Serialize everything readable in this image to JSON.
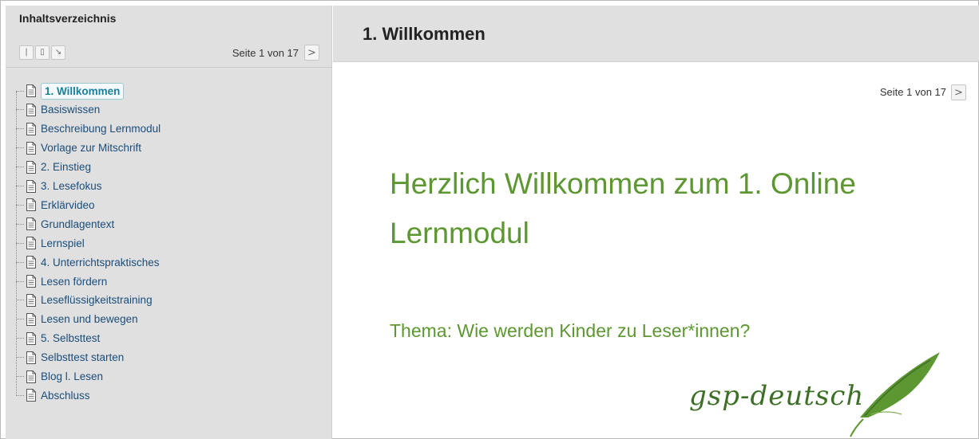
{
  "sidebar": {
    "title": "Inhaltsverzeichnis",
    "tools": [
      {
        "glyph": "|",
        "icon": "bar-icon"
      },
      {
        "glyph": "▯",
        "icon": "page-icon"
      },
      {
        "glyph": "↘",
        "icon": "arrow-icon"
      }
    ],
    "pager": {
      "label": "Seite 1 von 17",
      "next": ">"
    },
    "items": [
      {
        "label": "1. Willkommen",
        "active": true
      },
      {
        "label": "Basiswissen"
      },
      {
        "label": "Beschreibung Lernmodul"
      },
      {
        "label": "Vorlage zur Mitschrift"
      },
      {
        "label": "2. Einstieg"
      },
      {
        "label": "3. Lesefokus"
      },
      {
        "label": "Erklärvideo"
      },
      {
        "label": "Grundlagentext"
      },
      {
        "label": "Lernspiel"
      },
      {
        "label": "4. Unterrichtspraktisches"
      },
      {
        "label": "Lesen fördern"
      },
      {
        "label": "Leseflüssigkeitstraining"
      },
      {
        "label": "Lesen und bewegen"
      },
      {
        "label": "5. Selbsttest"
      },
      {
        "label": "Selbsttest starten"
      },
      {
        "label": "Blog l. Lesen"
      },
      {
        "label": "Abschluss"
      }
    ]
  },
  "content": {
    "title": "1. Willkommen",
    "pager": {
      "label": "Seite 1 von 17",
      "next": ">"
    },
    "heading_line1": "Herzlich Willkommen zum 1. Online",
    "heading_line2": "Lernmodul",
    "subtitle": "Thema: Wie werden Kinder zu Leser*innen?",
    "logo_text": "gsp-deutsch"
  },
  "colors": {
    "accent_green": "#5c9731",
    "panel_gray": "#e0e0e0",
    "active_border": "#9cc9d7",
    "link_blue": "#1a4d7a"
  }
}
